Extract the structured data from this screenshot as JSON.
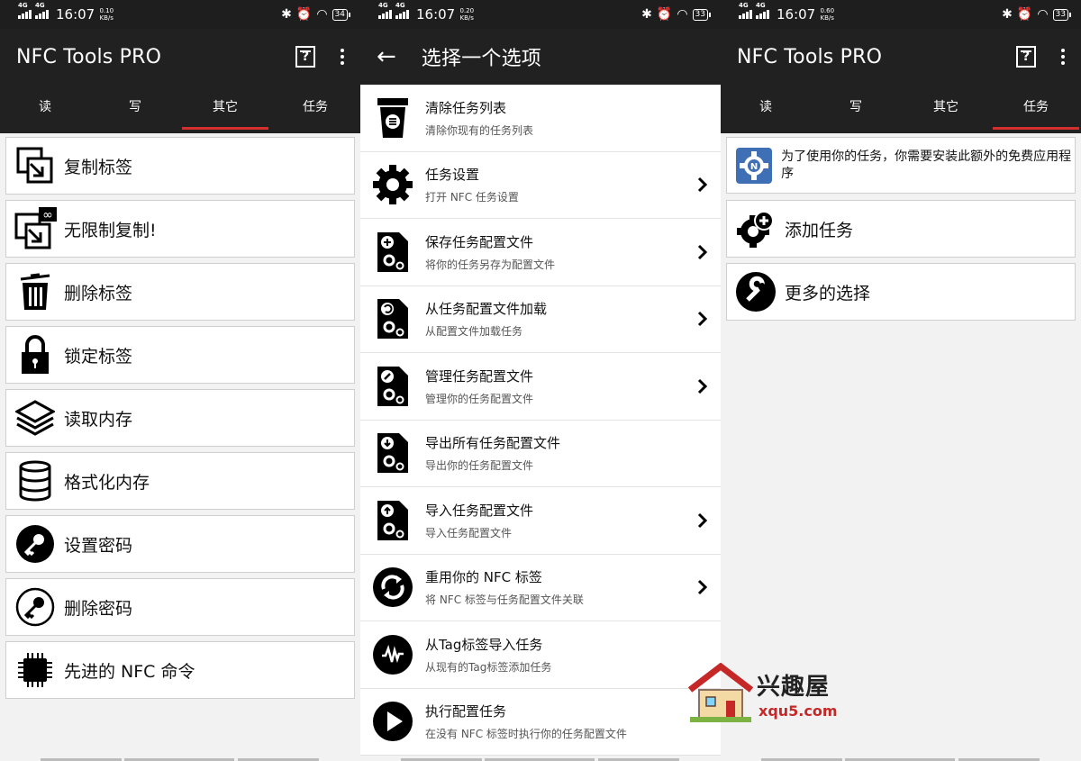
{
  "status_bars": [
    {
      "time": "16:07",
      "speed_value": "0.10",
      "speed_unit": "KB/s",
      "network": "4G HD",
      "battery": "34"
    },
    {
      "time": "16:07",
      "speed_value": "0.20",
      "speed_unit": "KB/s",
      "network": "4G HD",
      "battery": "33"
    },
    {
      "time": "16:07",
      "speed_value": "0.60",
      "speed_unit": "KB/s",
      "network": "4G HD",
      "battery": "33"
    }
  ],
  "panel1": {
    "title": "NFC Tools PRO",
    "tabs": [
      "读",
      "写",
      "其它",
      "任务"
    ],
    "active_tab": "其它",
    "items": [
      {
        "label": "复制标签",
        "icon": "copy-tag-icon"
      },
      {
        "label": "无限制复制!",
        "icon": "unlimited-copy-icon"
      },
      {
        "label": "删除标签",
        "icon": "trash-icon"
      },
      {
        "label": "锁定标签",
        "icon": "lock-icon"
      },
      {
        "label": "读取内存",
        "icon": "layers-icon"
      },
      {
        "label": "格式化内存",
        "icon": "database-icon"
      },
      {
        "label": "设置密码",
        "icon": "key-icon"
      },
      {
        "label": "删除密码",
        "icon": "key-outline-icon"
      },
      {
        "label": "先进的 NFC 命令",
        "icon": "chip-icon"
      }
    ]
  },
  "panel2": {
    "title": "选择一个选项",
    "items": [
      {
        "title": "清除任务列表",
        "subtitle": "清除你现有的任务列表",
        "icon": "clear-list-icon",
        "chevron": false
      },
      {
        "title": "任务设置",
        "subtitle": "打开 NFC 任务设置",
        "icon": "gear-icon",
        "chevron": true
      },
      {
        "title": "保存任务配置文件",
        "subtitle": "将你的任务另存为配置文件",
        "icon": "save-profile-icon",
        "chevron": true
      },
      {
        "title": "从任务配置文件加载",
        "subtitle": "从配置文件加载任务",
        "icon": "load-profile-icon",
        "chevron": true
      },
      {
        "title": "管理任务配置文件",
        "subtitle": "管理你的任务配置文件",
        "icon": "manage-profile-icon",
        "chevron": true
      },
      {
        "title": "导出所有任务配置文件",
        "subtitle": "导出你的任务配置文件",
        "icon": "export-profile-icon",
        "chevron": true
      },
      {
        "title": "导入任务配置文件",
        "subtitle": "导入任务配置文件",
        "icon": "import-profile-icon",
        "chevron": true
      },
      {
        "title": "重用你的 NFC 标签",
        "subtitle": "将 NFC 标签与任务配置文件关联",
        "icon": "reuse-tag-icon",
        "chevron": true
      },
      {
        "title": "从Tag标签导入任务",
        "subtitle": "从现有的Tag标签添加任务",
        "icon": "tag-import-icon",
        "chevron": false
      },
      {
        "title": "执行配置任务",
        "subtitle": "在没有 NFC 标签时执行你的任务配置文件",
        "icon": "play-icon",
        "chevron": false
      }
    ]
  },
  "panel3": {
    "title": "NFC Tools PRO",
    "tabs": [
      "读",
      "写",
      "其它",
      "任务"
    ],
    "active_tab": "任务",
    "info_text": "为了使用你的任务，你需要安装此额外的免费应用程序",
    "items": [
      {
        "label": "添加任务",
        "icon": "add-task-icon"
      },
      {
        "label": "更多的选择",
        "icon": "wrench-icon"
      }
    ]
  },
  "watermark": {
    "cn": "兴趣屋",
    "en": "xqu5.com"
  },
  "colors": {
    "appbar": "#212121",
    "status": "#1e1e1e",
    "accent": "#d32f2f",
    "background": "#f2f2f2"
  }
}
